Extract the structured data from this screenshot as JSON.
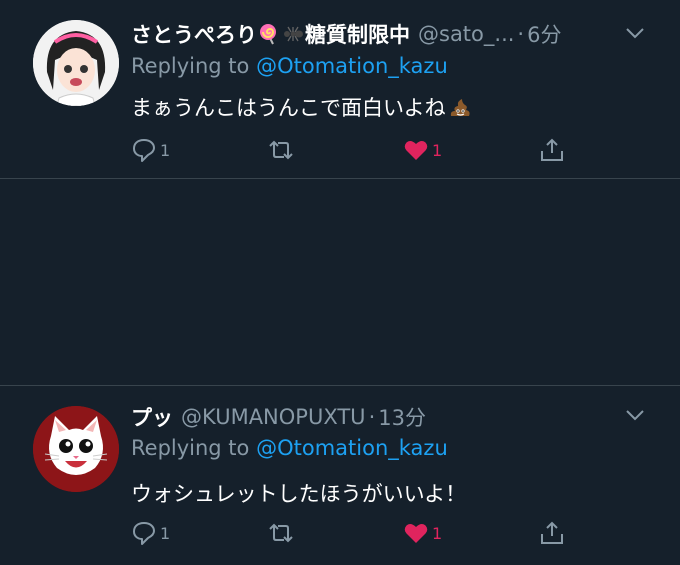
{
  "colors": {
    "background": "#15202b",
    "divider": "#38444d",
    "secondary_text": "#8899a6",
    "link": "#1da1f2",
    "like": "#e0245e"
  },
  "tweets": [
    {
      "display_name": "さとうぺろり",
      "name_suffix": "糖質制限中",
      "name_emojis": [
        "lollipop-emoji",
        "ant-emoji"
      ],
      "handle": "@sato_...",
      "time": "6分",
      "replying_prefix": "Replying to",
      "replying_to": "@Otomation_kazu",
      "text": "まぁうんこはうんこで面白いよね",
      "text_emoji": "poop-emoji",
      "reply_count": "1",
      "retweet_count": "",
      "like_count": "1",
      "liked": true
    },
    {
      "display_name": "プッ",
      "name_suffix": "",
      "name_emojis": [],
      "handle": "@KUMANOPUXTU",
      "time": "13分",
      "replying_prefix": "Replying to",
      "replying_to": "@Otomation_kazu",
      "text": "ウォシュレットしたほうがいいよ！",
      "text_emoji": "",
      "reply_count": "1",
      "retweet_count": "",
      "like_count": "1",
      "liked": true
    }
  ]
}
